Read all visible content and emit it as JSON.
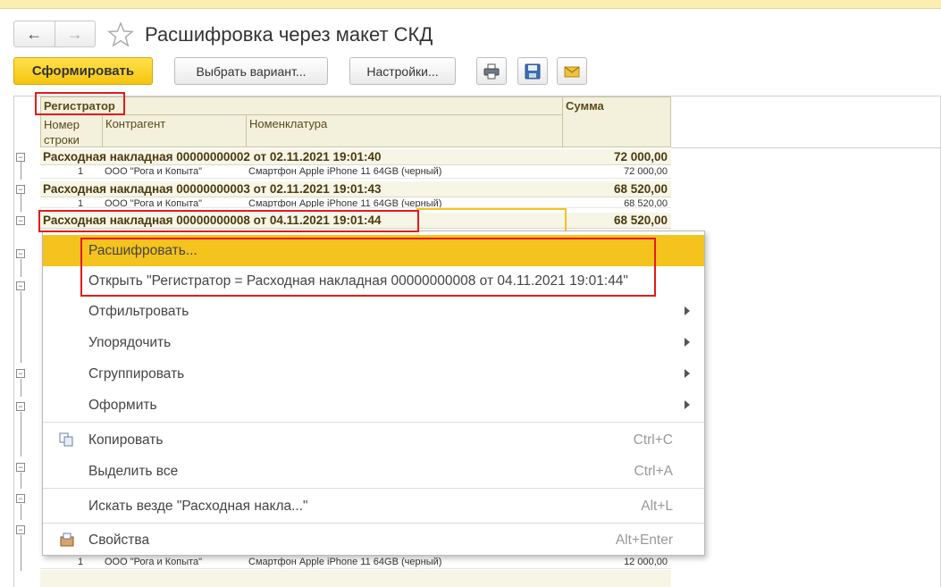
{
  "window": {
    "title": "Расшифровка через макет СКД"
  },
  "nav": {
    "back_icon": "arrow-left-icon",
    "forward_icon": "arrow-right-icon",
    "favorite_icon": "star-icon"
  },
  "toolbar": {
    "generate_label": "Сформировать",
    "choose_variant_label": "Выбрать вариант...",
    "settings_label": "Настройки...",
    "icons": [
      "print-icon",
      "save-icon",
      "mail-icon"
    ]
  },
  "report": {
    "headers": {
      "registrar": "Регистратор",
      "sum": "Сумма",
      "line_no": "Номер строки",
      "counterparty": "Контрагент",
      "nomenclature": "Номенклатура"
    },
    "groups": [
      {
        "label": "Расходная накладная 00000000002 от 02.11.2021 19:01:40",
        "sum": "72 000,00",
        "row": {
          "no": "1",
          "counterparty": "ООО \"Рога и Копыта\"",
          "item": "Смартфон Apple iPhone 11 64GB (черный)",
          "sum": "72 000,00"
        }
      },
      {
        "label": "Расходная накладная 00000000003 от 02.11.2021 19:01:43",
        "sum": "68 520,00",
        "row": {
          "no": "1",
          "counterparty": "ООО \"Рога и Копыта\"",
          "item": "Смартфон Apple iPhone 11 64GB (черный)",
          "sum": "68 520,00"
        }
      },
      {
        "label": "Расходная накладная 00000000008 от 04.11.2021 19:01:44",
        "sum": "68 520,00"
      }
    ],
    "last_row": {
      "no": "1",
      "counterparty": "ООО \"Рога и Копыта\"",
      "item": "Смартфон Apple iPhone 11 64GB (черный)",
      "sum": "12 000,00"
    }
  },
  "context_menu": {
    "items": [
      {
        "label": "Расшифровать...",
        "selected": true
      },
      {
        "label": "Открыть \"Регистратор = Расходная накладная 00000000008 от 04.11.2021 19:01:44\""
      },
      {
        "label": "Отфильтровать",
        "submenu": true
      },
      {
        "label": "Упорядочить",
        "submenu": true
      },
      {
        "label": "Сгруппировать",
        "submenu": true
      },
      {
        "label": "Оформить",
        "submenu": true
      },
      {
        "label": "Копировать",
        "shortcut": "Ctrl+C",
        "icon": "copy-icon"
      },
      {
        "label": "Выделить все",
        "shortcut": "Ctrl+A"
      },
      {
        "label": "Искать везде \"Расходная накла...\"",
        "shortcut": "Alt+L"
      },
      {
        "label": "Свойства",
        "shortcut": "Alt+Enter",
        "icon": "properties-icon"
      }
    ]
  },
  "colors": {
    "accent": "#f5c31d",
    "highlight_border": "#e31b1b",
    "header_bg": "#f3f0dc"
  }
}
